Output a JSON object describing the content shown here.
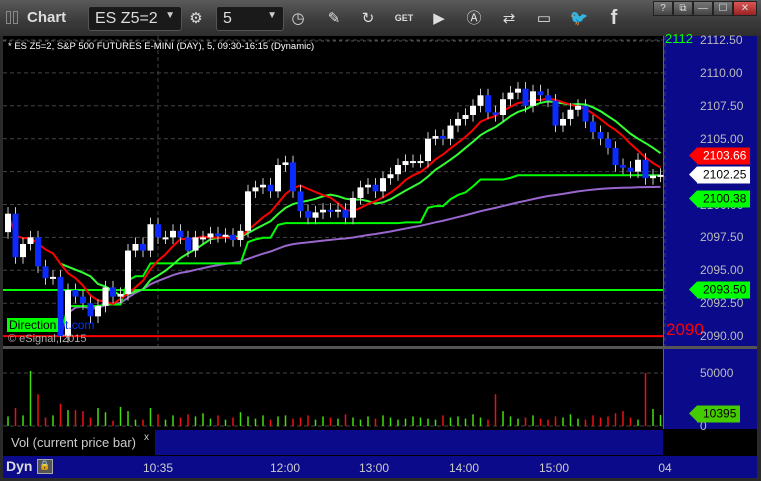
{
  "window": {
    "title": "Chart",
    "help": "?",
    "min": "—",
    "max": "☐",
    "close": "✕",
    "link": "⧉"
  },
  "toolbar": {
    "symbol": "ES Z5=2",
    "interval": "5",
    "icons": [
      "symbol-settings-icon",
      "interval-clock-icon",
      "pencil-icon",
      "refresh-icon",
      "get-icon",
      "play-icon",
      "alert-icon",
      "link-icon",
      "comment-icon",
      "twitter-icon",
      "facebook-icon"
    ],
    "get_label": "GET",
    "facebook_label": "f"
  },
  "chart": {
    "info": "* ES Z5=2, S&P 500 FUTURES E-MINI (DAY), 5, 09:30-16:15 (Dynamic)",
    "watermark_green": "Direction",
    "watermark_blue": "nt.com",
    "copyright": "© eSignal, 2015",
    "red_line_label": "2090",
    "top_label": "2112"
  },
  "price_axis": {
    "labels": [
      "2112.50",
      "2110.00",
      "2107.50",
      "2105.00",
      "2102.50",
      "2100.00",
      "2097.50",
      "2095.00",
      "2092.50",
      "2090.00"
    ],
    "tags": [
      {
        "value": "2103.66",
        "color": "#ff0000",
        "text": "#ffffff"
      },
      {
        "value": "2102.25",
        "color": "#ffffff",
        "text": "#000000"
      },
      {
        "value": "2100.38",
        "color": "#00ff00",
        "text": "#000000"
      },
      {
        "value": "2093.50",
        "color": "#00ff00",
        "text": "#000000"
      }
    ]
  },
  "volume": {
    "legend": "Vol (current price bar)",
    "close": "x",
    "axis": [
      "50000",
      "0"
    ],
    "tag": "10395"
  },
  "time_axis": {
    "dyn": "Dyn",
    "labels": [
      "10:35",
      "12:00",
      "13:00",
      "14:00",
      "15:00",
      "04"
    ]
  },
  "chart_data": {
    "type": "candlestick",
    "ylim": [
      2089.5,
      2112.5
    ],
    "first_open": 2097.9,
    "closes": [
      2099.3,
      2096,
      2097,
      2097.5,
      2095.3,
      2094.4,
      2094.5,
      2090,
      2093.5,
      2093,
      2092.5,
      2091.5,
      2092.3,
      2093.7,
      2093,
      2093.2,
      2096.5,
      2097,
      2096.5,
      2098.5,
      2097.5,
      2097.5,
      2098,
      2097.5,
      2096.5,
      2097.5,
      2097.5,
      2097.8,
      2097.6,
      2097.7,
      2097.3,
      2098,
      2101,
      2101.3,
      2101.5,
      2101,
      2103,
      2103.2,
      2101,
      2099.5,
      2099,
      2099.4,
      2099.6,
      2099.5,
      2099.6,
      2099,
      2100.5,
      2101.3,
      2101.5,
      2101,
      2102,
      2102.3,
      2103,
      2103.3,
      2103.3,
      2103.3,
      2105,
      2105.2,
      2105,
      2106,
      2106.5,
      2106.8,
      2107.5,
      2108.3,
      2107,
      2106.8,
      2108,
      2108.5,
      2108.8,
      2107.5,
      2108.6,
      2108.3,
      2107.9,
      2106,
      2106.5,
      2107.2,
      2107.5,
      2106.3,
      2105.5,
      2105,
      2104.3,
      2103,
      2102.8,
      2102.5,
      2103.4,
      2102,
      2102.2,
      2102.25
    ],
    "volumes": [
      9000,
      17000,
      10000,
      52000,
      30000,
      8000,
      10000,
      21000,
      15000,
      15000,
      14000,
      8000,
      17000,
      13000,
      5000,
      18000,
      14000,
      6000,
      6000,
      17000,
      11000,
      6000,
      10000,
      8000,
      11000,
      9000,
      12000,
      7000,
      10000,
      6000,
      8000,
      13000,
      9000,
      7000,
      10000,
      6000,
      9000,
      10000,
      7000,
      8000,
      10000,
      6000,
      9000,
      8000,
      7000,
      11000,
      8000,
      6000,
      9000,
      7000,
      10000,
      8000,
      6000,
      7000,
      9000,
      8000,
      7000,
      6000,
      10000,
      8000,
      9000,
      7000,
      11000,
      8000,
      6000,
      30000,
      14000,
      9000,
      7000,
      8000,
      10000,
      7000,
      6000,
      9000,
      8000,
      11000,
      7000,
      6000,
      10000,
      8000,
      9000,
      12000,
      14000,
      8000,
      6000,
      50000,
      16000,
      10395
    ],
    "hlines": [
      {
        "value": 2093.5,
        "color": "#00ff00"
      },
      {
        "value": 2090,
        "color": "#ff0000"
      }
    ]
  }
}
